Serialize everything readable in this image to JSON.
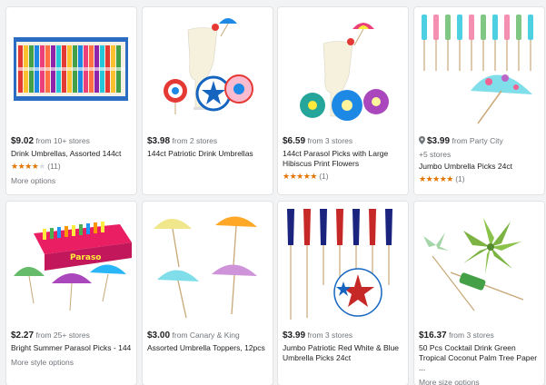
{
  "products": [
    {
      "price": "$9.02",
      "from": "from 10+ stores",
      "title": "Drink Umbrellas, Assorted 144ct",
      "rating": "4.5",
      "rating_count": "(11)",
      "more": "More options",
      "image_icon": "drink-umbrellas-box"
    },
    {
      "price": "$3.98",
      "from": "from 2 stores",
      "title": "144ct Patriotic Drink Umbrellas",
      "image_icon": "cocktail-patriotic-umbrellas"
    },
    {
      "price": "$6.59",
      "from": "from 3 stores",
      "title": "144ct Parasol Picks with Large Hibiscus Print Flowers",
      "rating": "5",
      "rating_count": "(1)",
      "image_icon": "cocktail-hibiscus-parasols"
    },
    {
      "price": "$3.99",
      "from": "from Party City",
      "stores": "+5 stores",
      "title": "Jumbo Umbrella Picks 24ct",
      "rating": "5",
      "rating_count": "(1)",
      "image_icon": "jumbo-umbrella-picks"
    },
    {
      "price": "$2.27",
      "from": "from 25+ stores",
      "title": "Bright Summer Parasol Picks - 144",
      "more": "More style options",
      "image_icon": "parasol-picks-box"
    },
    {
      "price": "$3.00",
      "from": "from Canary & King",
      "title": "Assorted Umbrella Toppers, 12pcs",
      "image_icon": "umbrella-toppers"
    },
    {
      "price": "$3.99",
      "from": "from 3 stores",
      "title": "Jumbo Patriotic Red White & Blue Umbrella Picks 24ct",
      "image_icon": "patriotic-umbrella-picks"
    },
    {
      "price": "$16.37",
      "from": "from 3 stores",
      "title": "50 Pcs Cocktail Drink Green Tropical Coconut Palm Tree Paper ...",
      "more": "More size options",
      "image_icon": "palm-tree-picks"
    }
  ],
  "colors": {
    "star": "#e37400",
    "muted": "#70757a"
  }
}
